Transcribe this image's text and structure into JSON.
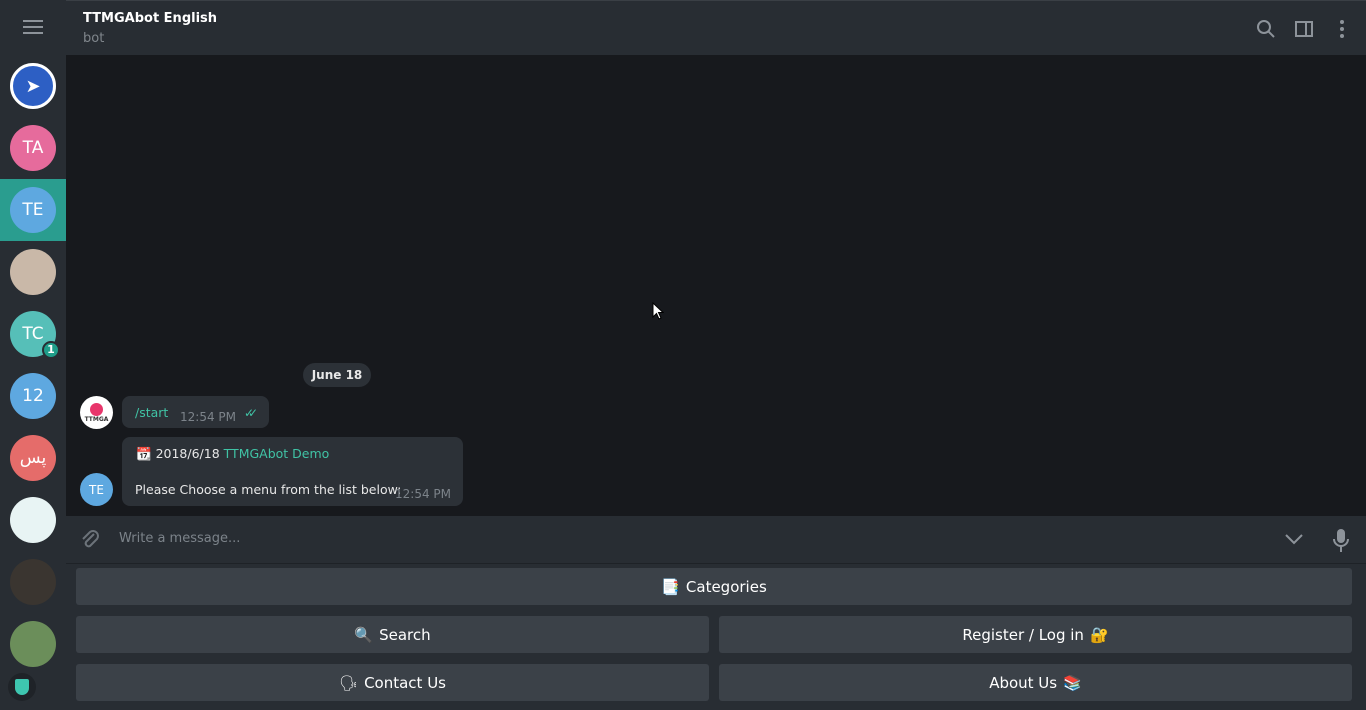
{
  "header": {
    "title": "TTMGAbot English",
    "subtitle": "bot"
  },
  "chats": [
    {
      "initials": "",
      "color": "#ffffff"
    },
    {
      "initials": "TA",
      "color": "#e66b9c"
    },
    {
      "initials": "TE",
      "color": "#5ea8e0",
      "active": true
    },
    {
      "initials": "",
      "color": "#c9b8a8"
    },
    {
      "initials": "TC",
      "color": "#56bfb8",
      "badge": "1"
    },
    {
      "initials": "12",
      "color": "#5ea8e0"
    },
    {
      "initials": "پس",
      "color": "#e56c6a"
    },
    {
      "initials": "",
      "color": "#e8f4f4"
    },
    {
      "initials": "",
      "color": "#3a3530"
    },
    {
      "initials": "",
      "color": "#6b8e5a"
    }
  ],
  "messages": {
    "date": "June 18",
    "m1": {
      "text": "/start",
      "time": "12:54 PM",
      "avatar_text": "TTMGA"
    },
    "m2": {
      "date": "2018/6/18",
      "name": "TTMGAbot Demo",
      "text": "Please Choose a menu from the list below:",
      "time": "12:54 PM",
      "avatar": "TE"
    }
  },
  "composer": {
    "placeholder": "Write a message..."
  },
  "keyboard": {
    "categories": "Categories",
    "categories_icon": "📑",
    "search": "Search",
    "search_icon": "🔍",
    "register": "Register / Log in",
    "register_icon": "🔐",
    "contact": "Contact Us",
    "contact_icon": "🗣",
    "about": "About Us",
    "about_icon": "📚"
  }
}
